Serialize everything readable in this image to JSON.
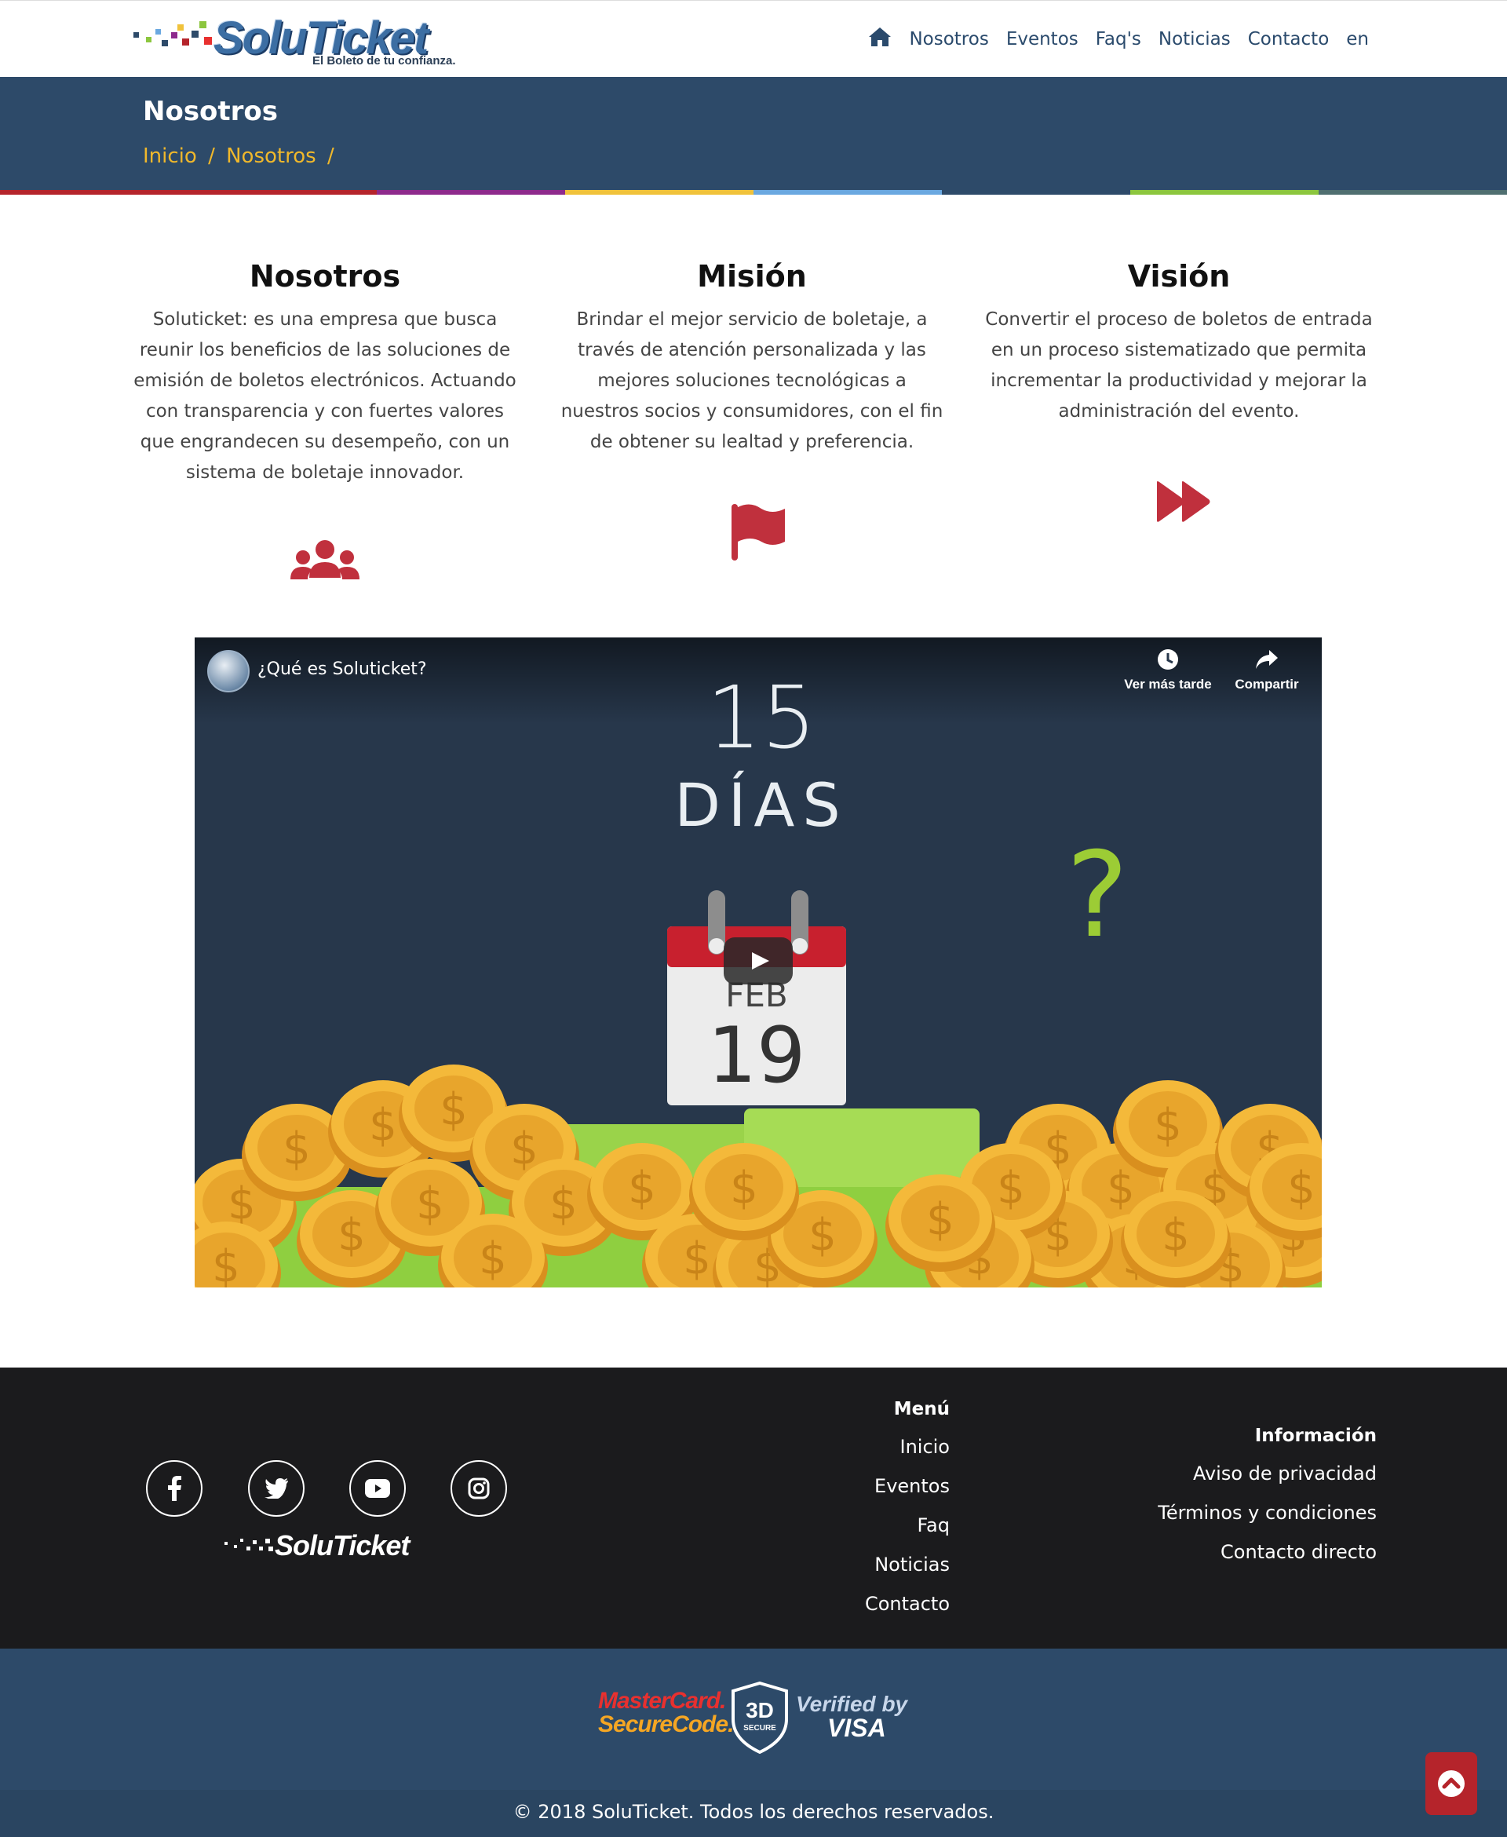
{
  "header": {
    "logo_text": "SoluTicket",
    "logo_tagline": "El Boleto de tu confianza.",
    "nav": [
      "Nosotros",
      "Eventos",
      "Faq's",
      "Noticias",
      "Contacto",
      "en"
    ]
  },
  "banner": {
    "title": "Nosotros",
    "breadcrumb": [
      "Inicio",
      "/",
      "Nosotros",
      "/"
    ]
  },
  "stripe_colors": [
    "#b5242b",
    "#b5242b",
    "#8e2a8c",
    "#f0c23b",
    "#6aa8e0",
    "#2d4a69",
    "#8cc63e",
    "#4f6f70"
  ],
  "sections": [
    {
      "title": "Nosotros",
      "text": "Soluticket: es una empresa que busca reunir los beneficios de las soluciones de emisión de boletos electrónicos. Actuando con transparencia y con fuertes valores que engrandecen su desempeño, con un sistema de boletaje innovador.",
      "icon": "users-icon"
    },
    {
      "title": "Misión",
      "text": "Brindar el mejor servicio de boletaje, a través de atención personalizada y las mejores soluciones tecnológicas a nuestros socios y consumidores, con el fin de obtener su lealtad y preferencia.",
      "icon": "flag-icon"
    },
    {
      "title": "Visión",
      "text": "Convertir el proceso de boletos de entrada en un proceso sistematizado que permita incrementar la productividad y mejorar la administración del evento.",
      "icon": "fast-forward-icon"
    }
  ],
  "video": {
    "title": "¿Qué es Soluticket?",
    "watch_later": "Ver más tarde",
    "share": "Compartir",
    "scene_days_number": "15",
    "scene_days_word": "DÍAS",
    "scene_month": "FEB",
    "scene_day": "19",
    "scene_question": "?"
  },
  "footer": {
    "socials": [
      "facebook-icon",
      "twitter-icon",
      "youtube-icon",
      "instagram-icon"
    ],
    "logo_text": "SoluTicket",
    "menu_title": "Menú",
    "menu": [
      "Inicio",
      "Eventos",
      "Faq",
      "Noticias",
      "Contacto"
    ],
    "info_title": "Información",
    "info": [
      "Aviso de privacidad",
      "Términos y condiciones",
      "Contacto directo"
    ]
  },
  "payments": {
    "mastercard_line1": "MasterCard.",
    "mastercard_line2": "SecureCode.",
    "secure_3d": "3D",
    "secure_label": "SECURE",
    "visa_line1": "Verified by",
    "visa_line2": "VISA"
  },
  "copyright": "© 2018 SoluTicket. Todos los derechos reservados.",
  "colors": {
    "brand_blue": "#2d4a69",
    "accent_red": "#c0303d",
    "breadcrumb_yellow": "#f0b82b",
    "footer_dark": "#1b1b1d"
  }
}
